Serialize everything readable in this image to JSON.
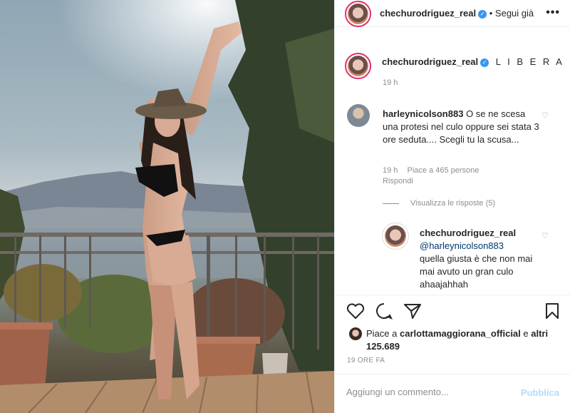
{
  "post": {
    "author": "chechurodriguez_real",
    "header_separator": "•",
    "follow_status": "Segui già",
    "verified_icon": "verified-badge-icon",
    "more_icon": "more-options-icon",
    "more_glyph": "•••",
    "caption": "L I B E R A",
    "caption_time": "19 h"
  },
  "comments": [
    {
      "user": "harleynicolson883",
      "text": "O se ne scesa una protesi nel culo oppure sei stata 3 ore seduta.... Scegli tu la scusa...",
      "time": "19 h",
      "likes": "Piace a 465 persone",
      "reply_label": "Rispondi",
      "view_replies": "Visualizza le risposte (5)",
      "reply": {
        "user": "chechurodriguez_real",
        "mention": "@harleynicolson883",
        "text": "quella giusta è che non mai mai avuto un gran culo ahaajahhah"
      }
    }
  ],
  "likes": {
    "prefix": "Piace a",
    "user": "carlottamaggiorana_official",
    "conjunction": "e",
    "others": "altri 125.689"
  },
  "post_time": "19 ORE FA",
  "comment_box": {
    "placeholder": "Aggiungi un commento...",
    "publish_label": "Pubblica"
  },
  "colors": {
    "accent": "#3897f0",
    "publish_disabled": "#b3dbff",
    "muted": "#8e8e8e",
    "story_ring": "#e1306c"
  }
}
